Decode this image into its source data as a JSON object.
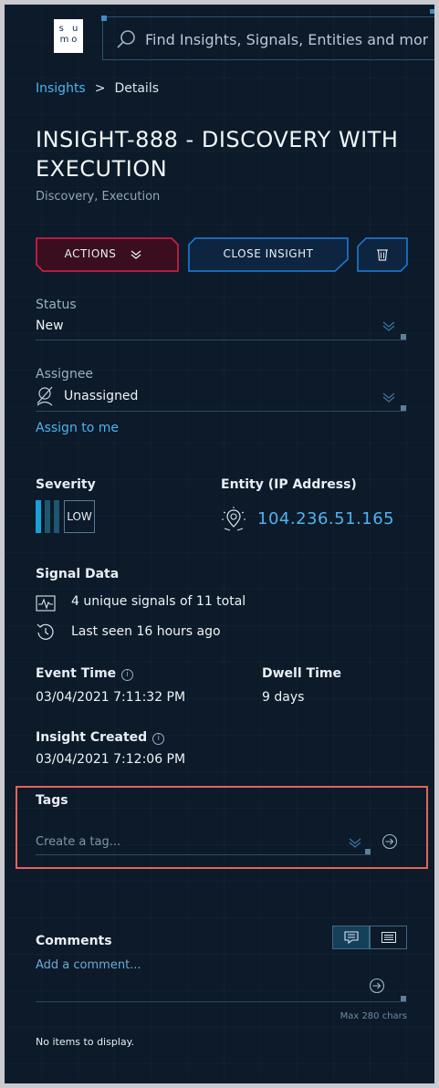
{
  "logo": {
    "line1": "s u",
    "line2": "mo"
  },
  "search": {
    "placeholder": "Find Insights, Signals, Entities and more"
  },
  "breadcrumb": {
    "parent": "Insights",
    "separator": ">",
    "current": "Details"
  },
  "insight": {
    "title": "INSIGHT-888 - DISCOVERY WITH EXECUTION",
    "subtitle": "Discovery, Execution"
  },
  "buttons": {
    "actions": "ACTIONS",
    "close": "CLOSE INSIGHT"
  },
  "status": {
    "label": "Status",
    "value": "New"
  },
  "assignee": {
    "label": "Assignee",
    "value": "Unassigned",
    "assign_link": "Assign to me"
  },
  "severity": {
    "label": "Severity",
    "value": "LOW"
  },
  "entity": {
    "label": "Entity (IP Address)",
    "value": "104.236.51.165"
  },
  "signal_data": {
    "label": "Signal Data",
    "signals": "4 unique signals of 11 total",
    "last_seen": "Last seen 16 hours ago"
  },
  "event_time": {
    "label": "Event Time",
    "value": "03/04/2021 7:11:32 PM"
  },
  "dwell_time": {
    "label": "Dwell Time",
    "value": "9 days"
  },
  "insight_created": {
    "label": "Insight Created",
    "value": "03/04/2021 7:12:06 PM"
  },
  "tags": {
    "label": "Tags",
    "placeholder": "Create a tag..."
  },
  "comments": {
    "label": "Comments",
    "placeholder": "Add a comment...",
    "max_chars": "Max 280 chars",
    "empty": "No items to display."
  },
  "colors": {
    "background": "#0c1a29",
    "accent": "#4eb3ef",
    "actions_border": "#e0224a",
    "close_border": "#1f7fe0",
    "severity_low": "#1a9fd6",
    "highlight": "#e5635b"
  },
  "icons": {
    "search": "search-icon",
    "actions_chevron": "chevron-double-down-icon",
    "trash": "trash-icon",
    "unassigned": "unassigned-user-icon",
    "entity": "entity-ip-icon",
    "signals": "pulse-icon",
    "last_seen": "history-icon",
    "info": "info-icon",
    "submit": "circle-arrow-right-icon",
    "comment_view": "comment-icon",
    "list_view": "list-icon"
  }
}
